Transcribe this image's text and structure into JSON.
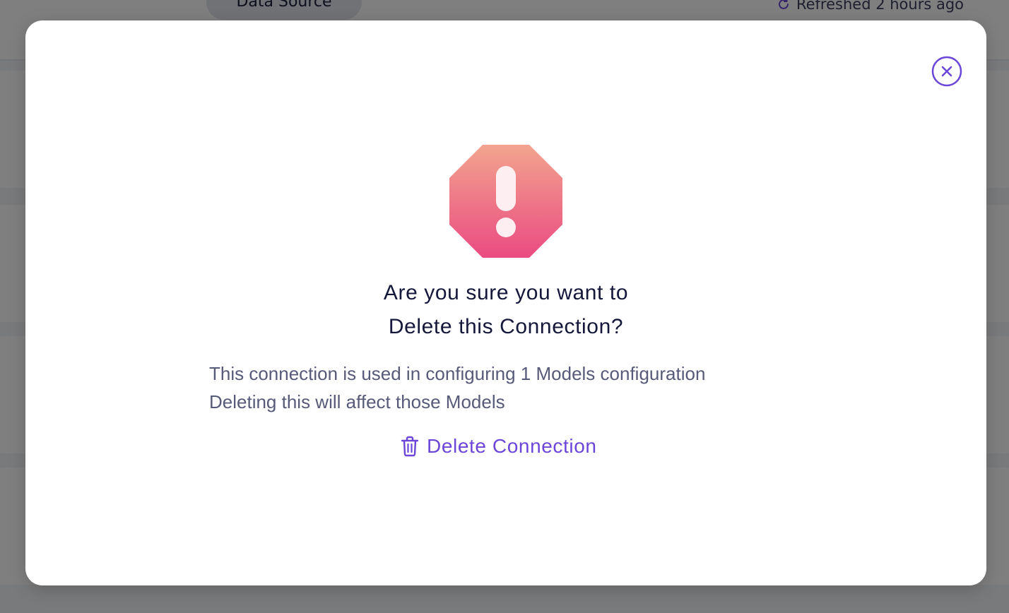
{
  "background": {
    "data_source_chip": "Data Source",
    "refresh_status": "Refreshed 2 hours ago"
  },
  "modal": {
    "close_icon": "close-circle-icon",
    "warning_icon": "octagon-exclamation-icon",
    "title_line1": "Are you sure you want to",
    "title_line2": "Delete this Connection?",
    "description_line1": "This connection is used in configuring 1 Models configuration",
    "description_line2": "Deleting this will affect those Models",
    "delete_button_label": "Delete Connection",
    "delete_button_icon": "trash-icon"
  },
  "colors": {
    "accent": "#6b46d8",
    "title": "#15173b",
    "description": "#575a78",
    "warning_gradient_top": "#f2a48e",
    "warning_gradient_bottom": "#ea4b82"
  }
}
